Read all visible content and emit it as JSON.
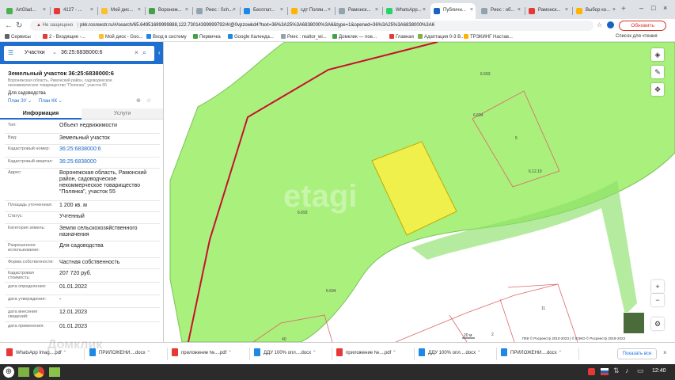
{
  "browser": {
    "tabs": [
      {
        "label": "ArtGlad...",
        "color": "#4caf50"
      },
      {
        "label": "4127 - ...",
        "color": "#e53935"
      },
      {
        "label": "Мой дис...",
        "color": "#fbc02d"
      },
      {
        "label": "Воронеж...",
        "color": "#43a047"
      },
      {
        "label": "Риес : Sch...",
        "color": "#90a4ae"
      },
      {
        "label": "Бесплат...",
        "color": "#1e88e5"
      },
      {
        "label": "сдт Полян...",
        "color": "#ffb300"
      },
      {
        "label": "Рамонск...",
        "color": "#90a4ae"
      },
      {
        "label": "WhatsApp...",
        "color": "#25d366"
      },
      {
        "label": "Публичн...",
        "color": "#1565c0"
      },
      {
        "label": "Риес : об...",
        "color": "#90a4ae"
      },
      {
        "label": "Рамонск...",
        "color": "#e53935"
      },
      {
        "label": "Выбор ко...",
        "color": "#ffb300"
      }
    ],
    "security_label": "Не защищено",
    "url": "pkk.rosreestr.ru/#/search/65.64951699999888,122.73014399999792/4/@0vpzowkd4?text=36%3A25%3A6838000%3A6&type=1&opened=36%3A25%3A6838000%3A6",
    "update_button": "Обновить",
    "bookmarks": [
      {
        "label": "Сервисы",
        "color": "#5f6368"
      },
      {
        "label": "2 - Входящие -...",
        "color": "#e53935"
      },
      {
        "label": "Мой диск - Goo...",
        "color": "#fbc02d"
      },
      {
        "label": "Вход в систему",
        "color": "#1e88e5"
      },
      {
        "label": "Первичка",
        "color": "#43a047"
      },
      {
        "label": "Google Календа...",
        "color": "#1e88e5"
      },
      {
        "label": "Риес : realtor_wi...",
        "color": "#90a4ae"
      },
      {
        "label": "Домклик — пое...",
        "color": "#43a047"
      },
      {
        "label": "Главная",
        "color": "#e53935"
      },
      {
        "label": "Адаптация 0-3 В...",
        "color": "#7cb342"
      },
      {
        "label": "ТРЭКИНГ Настав...",
        "color": "#ffb300"
      }
    ],
    "reading_list": "Список для чтения"
  },
  "panel": {
    "search_type": "Участки",
    "search_value": "36:25:6838000:6",
    "title": "Земельный участок 36:25:6838000:6",
    "address_short": "Воронежская область, Рамонский район, садоводческое некоммерческое товарищество \"Полянка\", участок 55",
    "purpose": "Для садоводства",
    "plan_zu": "План ЗУ",
    "plan_kk": "План КК",
    "tab_info": "Информация",
    "tab_services": "Услуги",
    "rows": [
      {
        "k": "Тип:",
        "v": "Объект недвижимости"
      },
      {
        "k": "Вид:",
        "v": "Земельный участок"
      },
      {
        "k": "Кадастровый номер:",
        "v": "36:25:6838000:6"
      },
      {
        "k": "Кадастровый квартал:",
        "v": "36:25:6838000"
      },
      {
        "k": "Адрес:",
        "v": "Воронежская область, Рамонский район, садоводческое некоммерческое товарищество \"Полянка\", участок 55"
      },
      {
        "k": "Площадь уточненная:",
        "v": "1 200 кв. м"
      },
      {
        "k": "Статус:",
        "v": "Учтенный"
      },
      {
        "k": "Категория земель:",
        "v": "Земли сельскохозяйственного назначения"
      },
      {
        "k": "Разрешенное использование:",
        "v": "Для садоводства"
      },
      {
        "k": "Форма собственности:",
        "v": "Частная собственность"
      },
      {
        "k": "Кадастровая стоимость:",
        "v": "207 720 руб."
      },
      {
        "k": "дата определения:",
        "v": "01.01.2022"
      },
      {
        "k": "дата утверждения:",
        "v": "-"
      },
      {
        "k": "дата внесения сведений:",
        "v": "12.01.2023"
      },
      {
        "k": "дата применения:",
        "v": "01.01.2023"
      }
    ]
  },
  "map": {
    "watermark": "etagi",
    "labels": [
      "6.693",
      "6.694",
      "5",
      "6.12.19",
      "6.693",
      "6.694",
      "11",
      "40",
      "2"
    ],
    "scale": "20 м",
    "copyright": "ПКК © Росреестр 2010-2023 | © ЕЭКО © Росреестр 2019-2023",
    "overlay_watermark": "Домклик",
    "land_color": "#a9f07d",
    "selected_color": "#f0f04c",
    "boundary_color": "#c8102e"
  },
  "downloads": {
    "items": [
      {
        "label": "WhatsApp Imag....pdf",
        "color": "#e53935"
      },
      {
        "label": "ПРИЛОЖЕНИ....docx",
        "color": "#1e88e5"
      },
      {
        "label": "приложение №....pdf",
        "color": "#e53935"
      },
      {
        "label": "ДДУ 100% опл....docx",
        "color": "#1e88e5"
      },
      {
        "label": "приложение №....pdf",
        "color": "#e53935"
      },
      {
        "label": "ДДУ 100% опл....docx",
        "color": "#1e88e5"
      },
      {
        "label": "ПРИЛОЖЕНИ....docx",
        "color": "#1e88e5"
      }
    ],
    "show_all": "Показать все"
  },
  "taskbar": {
    "clock": "12:40"
  }
}
